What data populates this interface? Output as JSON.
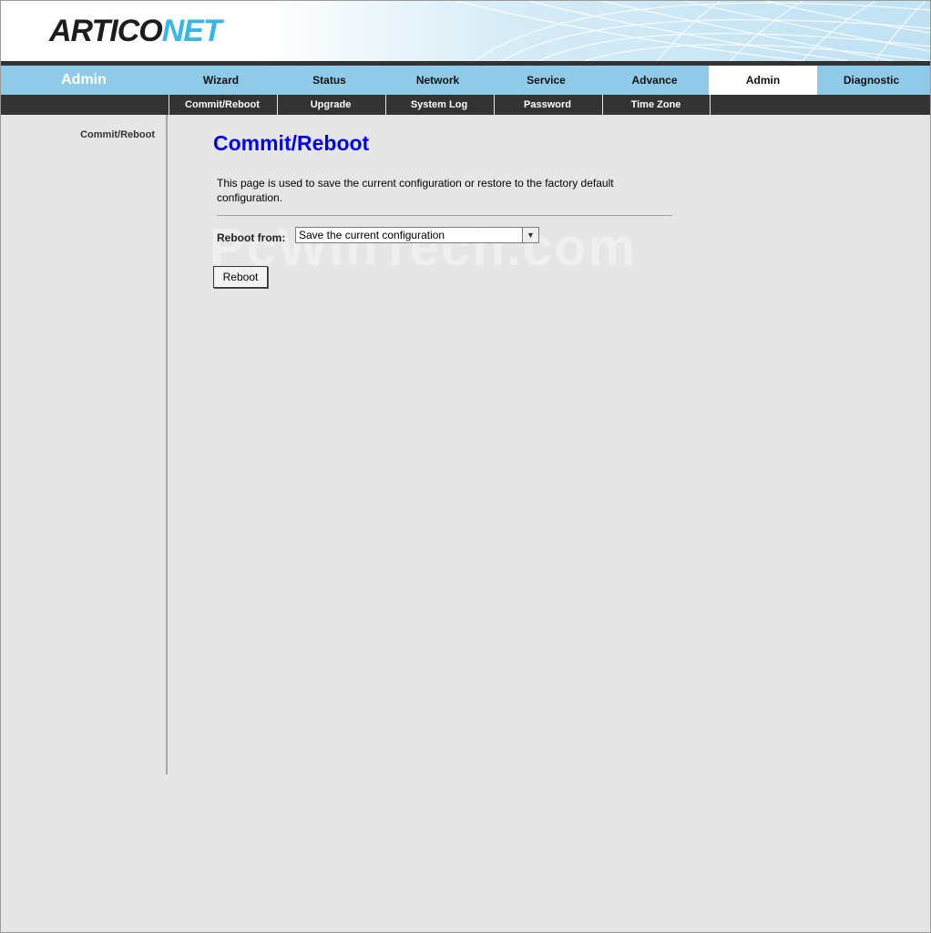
{
  "header": {
    "logo_part1": "ARTICO",
    "logo_part2": "NET"
  },
  "nav": {
    "section_name": "Admin",
    "items": [
      {
        "label": "Wizard"
      },
      {
        "label": "Status"
      },
      {
        "label": "Network"
      },
      {
        "label": "Service"
      },
      {
        "label": "Advance"
      },
      {
        "label": "Admin",
        "active": true
      },
      {
        "label": "Diagnostic"
      }
    ]
  },
  "subnav": {
    "items": [
      {
        "label": "Commit/Reboot"
      },
      {
        "label": "Upgrade"
      },
      {
        "label": "System Log"
      },
      {
        "label": "Password"
      },
      {
        "label": "Time Zone"
      }
    ]
  },
  "sidebar": {
    "items": [
      {
        "label": "Commit/Reboot"
      }
    ]
  },
  "main": {
    "title": "Commit/Reboot",
    "description": "This page is used to save the current configuration or restore to the factory default configuration.",
    "reboot_from_label": "Reboot from:",
    "reboot_from_value": "Save the current configuration",
    "reboot_button": "Reboot"
  },
  "watermark": "PcWinTech.com",
  "colors": {
    "nav_bg": "#8fcbe8",
    "subnav_bg": "#333333",
    "title": "#0000ee",
    "logo_accent": "#36b7e8"
  }
}
